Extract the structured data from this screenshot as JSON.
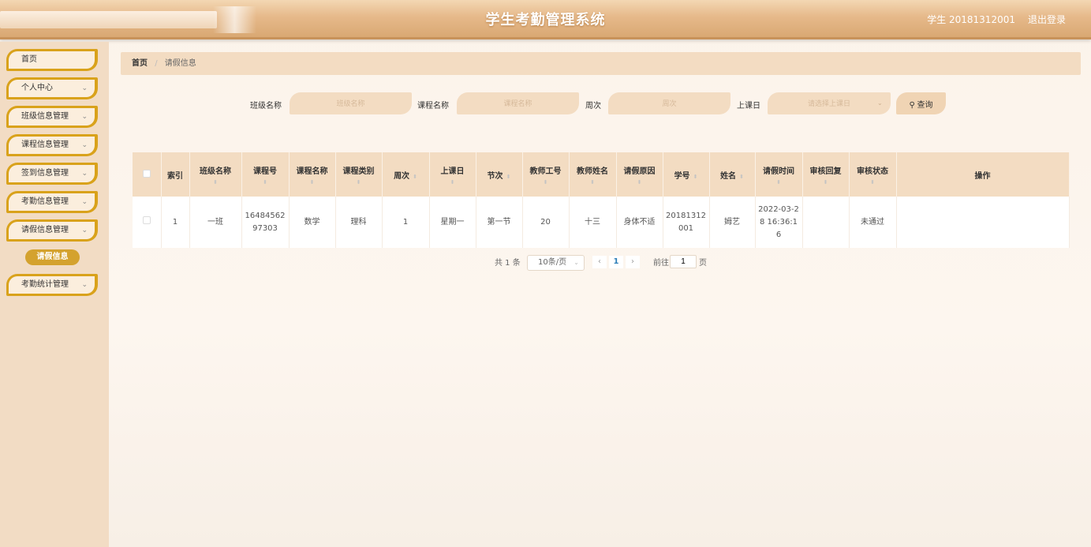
{
  "header": {
    "title": "学生考勤管理系统",
    "user": "学生 20181312001",
    "logout": "退出登录"
  },
  "sidebar": {
    "items": [
      {
        "label": "首页",
        "chevron": ""
      },
      {
        "label": "个人中心",
        "chevron": "⌄"
      },
      {
        "label": "班级信息管理",
        "chevron": "⌄"
      },
      {
        "label": "课程信息管理",
        "chevron": "⌄"
      },
      {
        "label": "签到信息管理",
        "chevron": "⌄"
      },
      {
        "label": "考勤信息管理",
        "chevron": "⌄"
      },
      {
        "label": "请假信息管理",
        "chevron": "⌄"
      },
      {
        "label": "考勤统计管理",
        "chevron": "⌄"
      }
    ],
    "sub_item": "请假信息"
  },
  "breadcrumb": {
    "home": "首页",
    "sep": "/",
    "current": "请假信息"
  },
  "search": {
    "class_label": "班级名称",
    "class_placeholder": "班级名称",
    "course_label": "课程名称",
    "course_placeholder": "课程名称",
    "week_label": "周次",
    "week_placeholder": "周次",
    "day_label": "上课日",
    "day_placeholder": "请选择上课日",
    "button": "查询"
  },
  "table": {
    "headers": [
      "索引",
      "班级名称",
      "课程号",
      "课程名称",
      "课程类别",
      "周次",
      "上课日",
      "节次",
      "教师工号",
      "教师姓名",
      "请假原因",
      "学号",
      "姓名",
      "请假时间",
      "审核回复",
      "审核状态",
      "操作"
    ],
    "rows": [
      {
        "index": "1",
        "class_name": "一班",
        "course_no": "1648456297303",
        "course_name": "数学",
        "course_type": "理科",
        "week": "1",
        "day": "星期一",
        "section": "第一节",
        "teacher_no": "20",
        "teacher_name": "十三",
        "reason": "身体不适",
        "student_no": "20181312001",
        "student_name": "姆艺",
        "leave_time": "2022-03-28 16:36:16",
        "reply": "",
        "status": "未通过",
        "actions": ""
      }
    ]
  },
  "pagination": {
    "total": "共 1 条",
    "page_size": "10条/页",
    "prev": "‹",
    "page": "1",
    "next": "›",
    "goto_label": "前往",
    "goto_value": "1",
    "page_unit": "页"
  },
  "colors": {
    "accent": "#d9a21b",
    "header": "#e6b98a",
    "panel": "#f3dcc2"
  }
}
